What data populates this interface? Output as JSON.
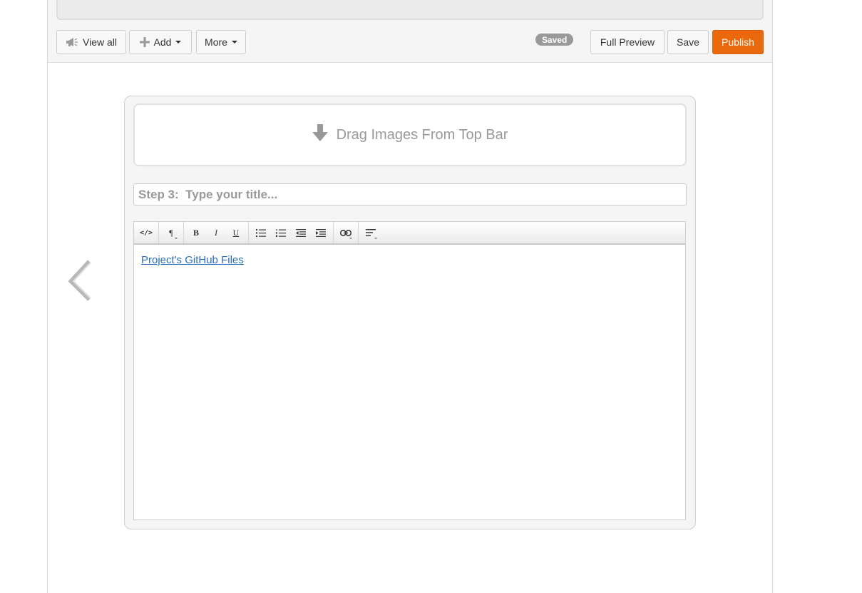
{
  "toolbar": {
    "view_all_label": "View all",
    "add_label": "Add",
    "more_label": "More",
    "saved_badge": "Saved",
    "full_preview_label": "Full Preview",
    "save_label": "Save",
    "publish_label": "Publish",
    "publish_color": "#e9690c"
  },
  "step": {
    "drop_zone_text": "Drag Images From Top Bar",
    "title_placeholder": "Step 3:  Type your title...",
    "title_value": ""
  },
  "editor": {
    "toolbar_icons": [
      "code-view-icon",
      "paragraph-icon",
      "bold-icon",
      "italic-icon",
      "underline-icon",
      "unordered-list-icon",
      "ordered-list-icon",
      "outdent-icon",
      "indent-icon",
      "link-icon",
      "align-icon"
    ],
    "body_link_text": "Project's GitHub Files"
  }
}
